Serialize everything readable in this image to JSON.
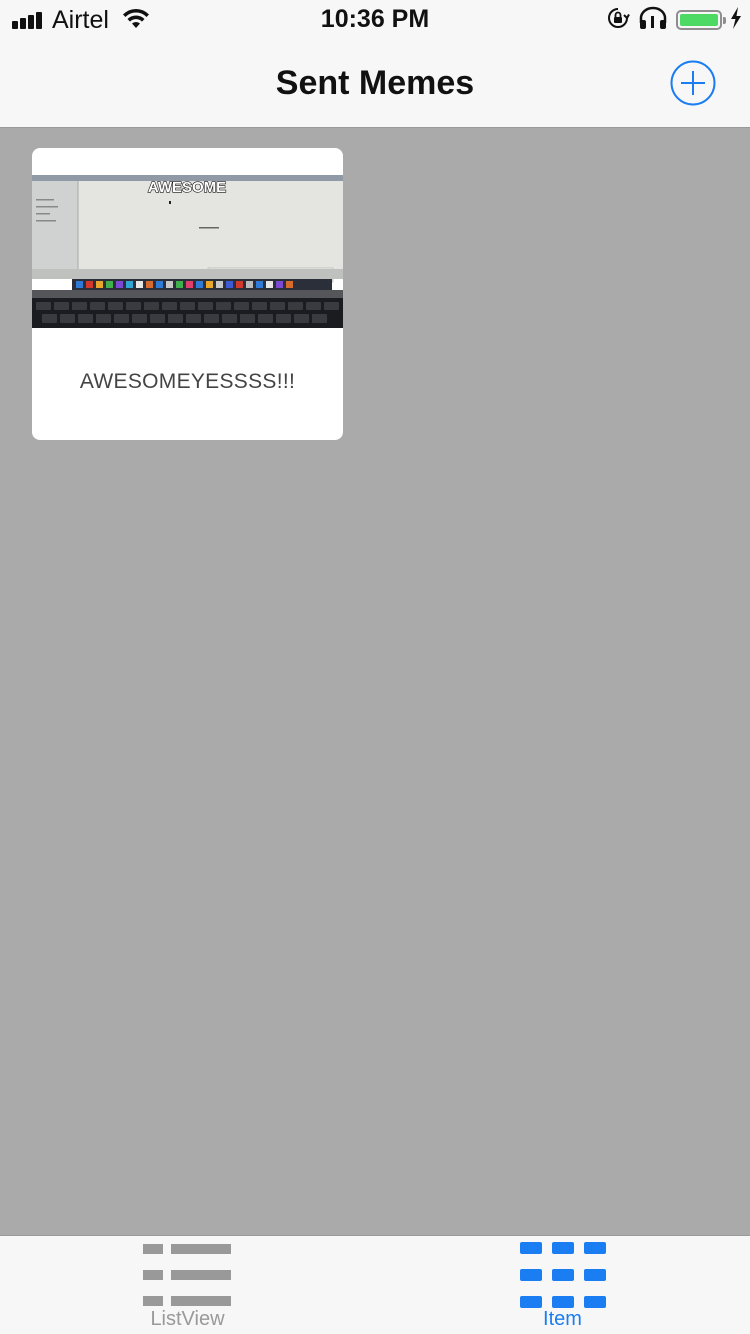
{
  "status_bar": {
    "carrier": "Airtel",
    "time": "10:36 PM",
    "icons": [
      "signal-bars-icon",
      "wifi-icon",
      "rotation-lock-icon",
      "headphones-icon",
      "battery-icon",
      "charging-bolt-icon"
    ],
    "battery_level": 1.0,
    "battery_color": "#4cd964"
  },
  "nav_bar": {
    "title": "Sent Memes",
    "add_icon": "plus-circle-icon",
    "accent": "#1a7df2"
  },
  "memes": [
    {
      "image_top_text": "AWESOME",
      "caption": "AWESOMEYESSSS!!!"
    }
  ],
  "tab_bar": {
    "tabs": [
      {
        "label": "ListView",
        "icon": "list-icon",
        "selected": false
      },
      {
        "label": "Item",
        "icon": "grid-icon",
        "selected": true
      }
    ],
    "selected_color": "#1a7df2",
    "unselected_color": "#999999"
  }
}
